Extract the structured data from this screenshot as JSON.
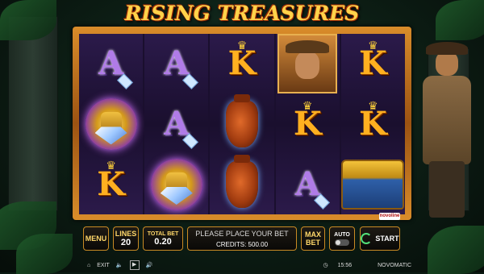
{
  "game": {
    "title": "RISING TREASURES",
    "provider": "NOVOMATIC",
    "badge": "novoline"
  },
  "reels": [
    [
      "A",
      "idol",
      "K"
    ],
    [
      "A",
      "A",
      "idol"
    ],
    [
      "K",
      "vase",
      "vase"
    ],
    [
      "hero",
      "K",
      "A"
    ],
    [
      "K",
      "K",
      "chest"
    ]
  ],
  "controls": {
    "menu_label": "MENU",
    "lines_label": "LINES",
    "lines_value": "20",
    "total_bet_label": "TOTAL BET",
    "total_bet_value": "0.20",
    "message": "PLEASE PLACE YOUR BET",
    "credits_label": "CREDITS:",
    "credits_value": "500.00",
    "max_bet_line1": "MAX",
    "max_bet_line2": "BET",
    "auto_label": "AUTO",
    "start_label": "START"
  },
  "bottom_bar": {
    "exit_label": "EXIT",
    "time": "15:56"
  },
  "icons": {
    "home": "home-icon",
    "sound": "speaker-icon",
    "clock": "clock-icon"
  }
}
